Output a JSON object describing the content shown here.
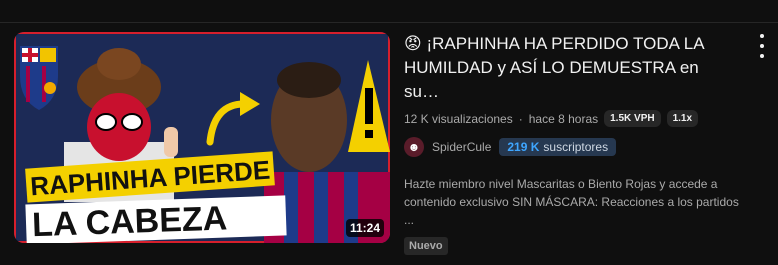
{
  "video": {
    "title_emoji": "😡",
    "title": "¡RAPHINHA HA PERDIDO TODA LA HUMILDAD y ASÍ LO DEMUESTRA en su…",
    "views": "12 K visualizaciones",
    "time_ago": "hace 8 horas",
    "vph_pill": "1.5K VPH",
    "ratio_pill": "1.1x",
    "duration": "11:24",
    "description": "Hazte miembro nivel Mascaritas o Biento Rojas y accede a contenido exclusivo SIN MÁSCARA: Reacciones a los partidos ...",
    "badge": "Nuevo"
  },
  "thumbnail": {
    "line1": "RAPHINHA PIERDE",
    "line2": "LA CABEZA"
  },
  "channel": {
    "name": "SpiderCule",
    "subscribers_number": "219 K",
    "subscribers_label": "suscriptores",
    "avatar_icon": "spider-mask-icon"
  },
  "colors": {
    "background": "#0f0f0f",
    "accent_blue": "#3ea6ff",
    "thumb_yellow": "#f4d000"
  }
}
